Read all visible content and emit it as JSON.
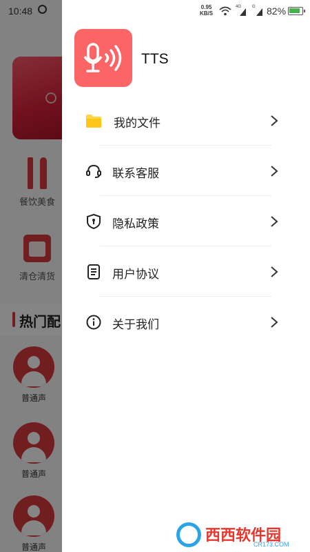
{
  "status_bar": {
    "time": "10:48",
    "net_speed": "0.95",
    "net_unit": "KB/S",
    "sig1_tag": "4G",
    "sig2_tag": "G",
    "battery": "82%"
  },
  "background": {
    "categories": [
      {
        "label": "餐饮美食",
        "icon": "cutlery-icon"
      },
      {
        "label": "清仓清货",
        "icon": "box-icon"
      }
    ],
    "section_title": "热门配",
    "voices": [
      "普通声",
      "普通声",
      "普通声"
    ]
  },
  "drawer": {
    "app_name": "TTS",
    "logo_icon": "microphone-icon",
    "logo_color": "#fb6565",
    "menu": [
      {
        "label": "我的文件",
        "icon": "folder-icon"
      },
      {
        "label": "联系客服",
        "icon": "headset-icon"
      },
      {
        "label": "隐私政策",
        "icon": "shield-icon"
      },
      {
        "label": "用户协议",
        "icon": "document-icon"
      },
      {
        "label": "关于我们",
        "icon": "info-icon"
      }
    ]
  },
  "watermark": {
    "text": "西西软件园",
    "url": "CR173.COM"
  }
}
